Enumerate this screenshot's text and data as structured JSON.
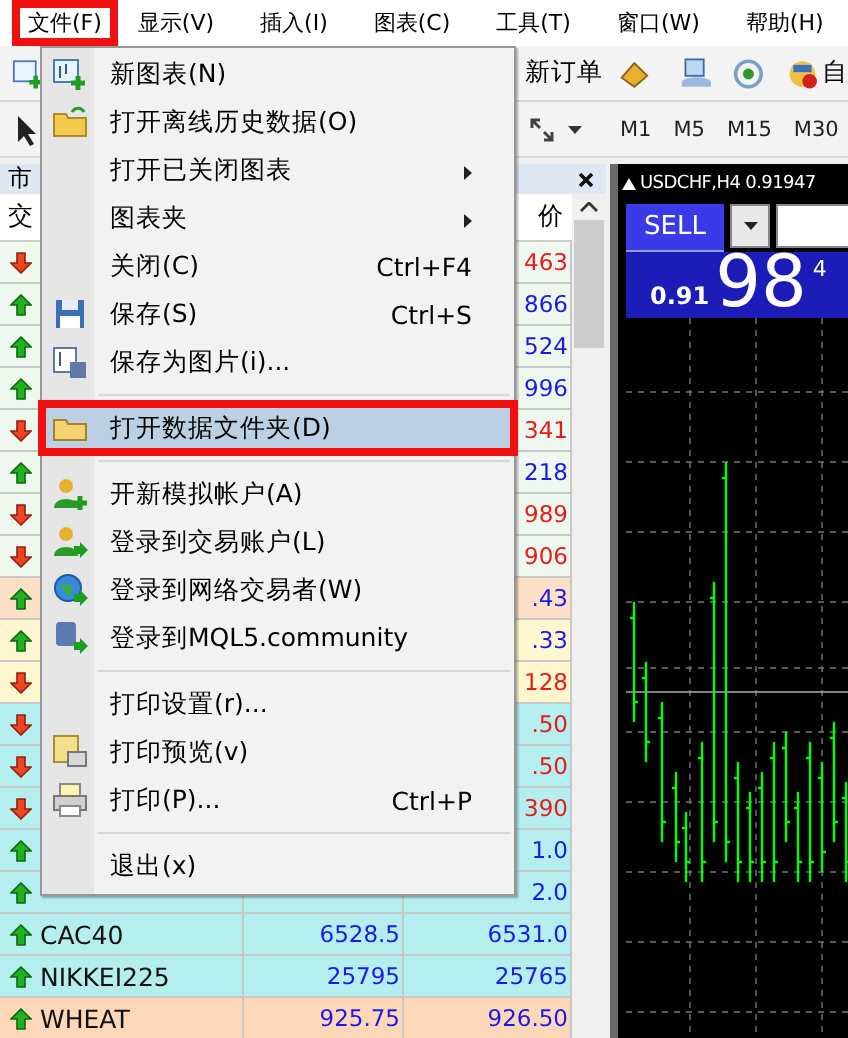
{
  "menu_bar": {
    "items": [
      {
        "label": "文件(F)",
        "selected": true
      },
      {
        "label": "显示(V)",
        "selected": false
      },
      {
        "label": "插入(I)",
        "selected": false
      },
      {
        "label": "图表(C)",
        "selected": false
      },
      {
        "label": "工具(T)",
        "selected": false
      },
      {
        "label": "窗口(W)",
        "selected": false
      },
      {
        "label": "帮助(H)",
        "selected": false
      }
    ]
  },
  "toolbar": {
    "new_order": "新订单",
    "auto_trading": "自"
  },
  "timeframes": [
    "M1",
    "M5",
    "M15",
    "M30"
  ],
  "market_watch": {
    "title": "市",
    "columns": [
      "交",
      "价"
    ],
    "rows": [
      {
        "kind": "down",
        "color": "#eef8ee",
        "ask": "463"
      },
      {
        "kind": "up",
        "color": "#eef8ee",
        "ask": "866"
      },
      {
        "kind": "up",
        "color": "#eef8ee",
        "ask": "524"
      },
      {
        "kind": "up",
        "color": "#eef8ee",
        "ask": "996"
      },
      {
        "kind": "down",
        "color": "#eef8ee",
        "ask": "341"
      },
      {
        "kind": "up",
        "color": "#eef8ee",
        "ask": "218"
      },
      {
        "kind": "down",
        "color": "#eef8ee",
        "ask": "989"
      },
      {
        "kind": "down",
        "color": "#eef8ee",
        "ask": "906"
      },
      {
        "kind": "up",
        "color": "#fde0c6",
        "ask": ".43"
      },
      {
        "kind": "up",
        "color": "#fdf8d0",
        "ask": ".33"
      },
      {
        "kind": "down",
        "color": "#fdf8d0",
        "ask": "128"
      },
      {
        "kind": "down",
        "color": "#b4eeee",
        "ask": ".50"
      },
      {
        "kind": "down",
        "color": "#b4eeee",
        "ask": ".50"
      },
      {
        "kind": "down",
        "color": "#b4eeee",
        "ask": "390"
      },
      {
        "kind": "up",
        "color": "#b4eeee",
        "ask": "1.0"
      },
      {
        "kind": "up",
        "color": "#b4eeee",
        "ask": "2.0"
      },
      {
        "kind": "up",
        "color": "#b4eeee",
        "symbol": "CAC40",
        "bid": "6528.5",
        "ask": "6531.0"
      },
      {
        "kind": "up",
        "color": "#b4eeee",
        "symbol": "NIKKEI225",
        "bid": "25795",
        "ask": "25765"
      },
      {
        "kind": "up",
        "color": "#fdd8b8",
        "symbol": "WHEAT",
        "bid": "925.75",
        "ask": "926.50"
      }
    ]
  },
  "chart": {
    "title": "USDCHF,H4 0.91947",
    "sell_label": "SELL",
    "price_prefix": "0.91",
    "price_big": "98",
    "price_sup": "4"
  },
  "file_menu": {
    "items": [
      {
        "kind": "item",
        "label": "新图表(N)",
        "selected": false,
        "submenu": false
      },
      {
        "kind": "item",
        "label": "打开离线历史数据(O)",
        "selected": false,
        "submenu": false
      },
      {
        "kind": "item",
        "label": "打开已关闭图表",
        "selected": false,
        "submenu": true
      },
      {
        "kind": "item",
        "label": "图表夹",
        "selected": false,
        "submenu": true
      },
      {
        "kind": "item",
        "label": "关闭(C)",
        "shortcut": "Ctrl+F4",
        "selected": false,
        "submenu": false
      },
      {
        "kind": "item",
        "label": "保存(S)",
        "shortcut": "Ctrl+S",
        "selected": false,
        "submenu": false
      },
      {
        "kind": "item",
        "label": "保存为图片(i)...",
        "selected": false,
        "submenu": false
      },
      {
        "kind": "separator"
      },
      {
        "kind": "item",
        "label": "打开数据文件夹(D)",
        "selected": true,
        "submenu": false
      },
      {
        "kind": "separator"
      },
      {
        "kind": "item",
        "label": "开新模拟帐户(A)",
        "selected": false,
        "submenu": false
      },
      {
        "kind": "item",
        "label": "登录到交易账户(L)",
        "selected": false,
        "submenu": false
      },
      {
        "kind": "item",
        "label": "登录到网络交易者(W)",
        "selected": false,
        "submenu": false
      },
      {
        "kind": "item",
        "label": "登录到MQL5.community",
        "selected": false,
        "submenu": false
      },
      {
        "kind": "separator"
      },
      {
        "kind": "item",
        "label": "打印设置(r)...",
        "selected": false,
        "submenu": false
      },
      {
        "kind": "item",
        "label": "打印预览(v)",
        "selected": false,
        "submenu": false
      },
      {
        "kind": "item",
        "label": "打印(P)...",
        "shortcut": "Ctrl+P",
        "selected": false,
        "submenu": false
      },
      {
        "kind": "separator"
      },
      {
        "kind": "item",
        "label": "退出(x)",
        "selected": false,
        "submenu": false
      }
    ]
  }
}
